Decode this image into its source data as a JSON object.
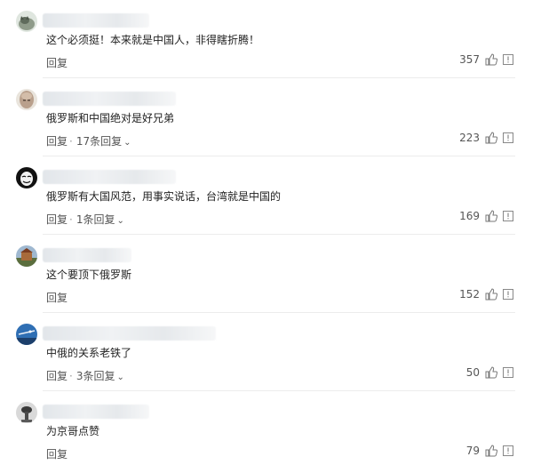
{
  "comments": [
    {
      "text": "这个必须挺！本来就是中国人，非得瞎折腾！",
      "reply_label": "回复",
      "reply_count": "",
      "likes": "357",
      "avatar": "wolf-avatar-icon"
    },
    {
      "text": "俄罗斯和中国绝对是好兄弟",
      "reply_label": "回复",
      "reply_count": "17条回复",
      "likes": "223",
      "avatar": "bald-man-avatar-icon"
    },
    {
      "text": "俄罗斯有大国风范，用事实说话，台湾就是中国的",
      "reply_label": "回复",
      "reply_count": "1条回复",
      "likes": "169",
      "avatar": "mask-avatar-icon"
    },
    {
      "text": "这个要顶下俄罗斯",
      "reply_label": "回复",
      "reply_count": "",
      "likes": "152",
      "avatar": "castle-avatar-icon"
    },
    {
      "text": "中俄的关系老铁了",
      "reply_label": "回复",
      "reply_count": "3条回复",
      "likes": "50",
      "avatar": "blue-sky-avatar-icon"
    },
    {
      "text": "为京哥点赞",
      "reply_label": "回复",
      "reply_count": "",
      "likes": "79",
      "avatar": "statue-avatar-icon"
    }
  ],
  "icons": {
    "like": "thumbs-up-icon",
    "report": "report-icon",
    "expand": "chevron-down-icon"
  },
  "colors": {
    "text": "#222222",
    "muted": "#555555",
    "divider": "#ececec"
  }
}
